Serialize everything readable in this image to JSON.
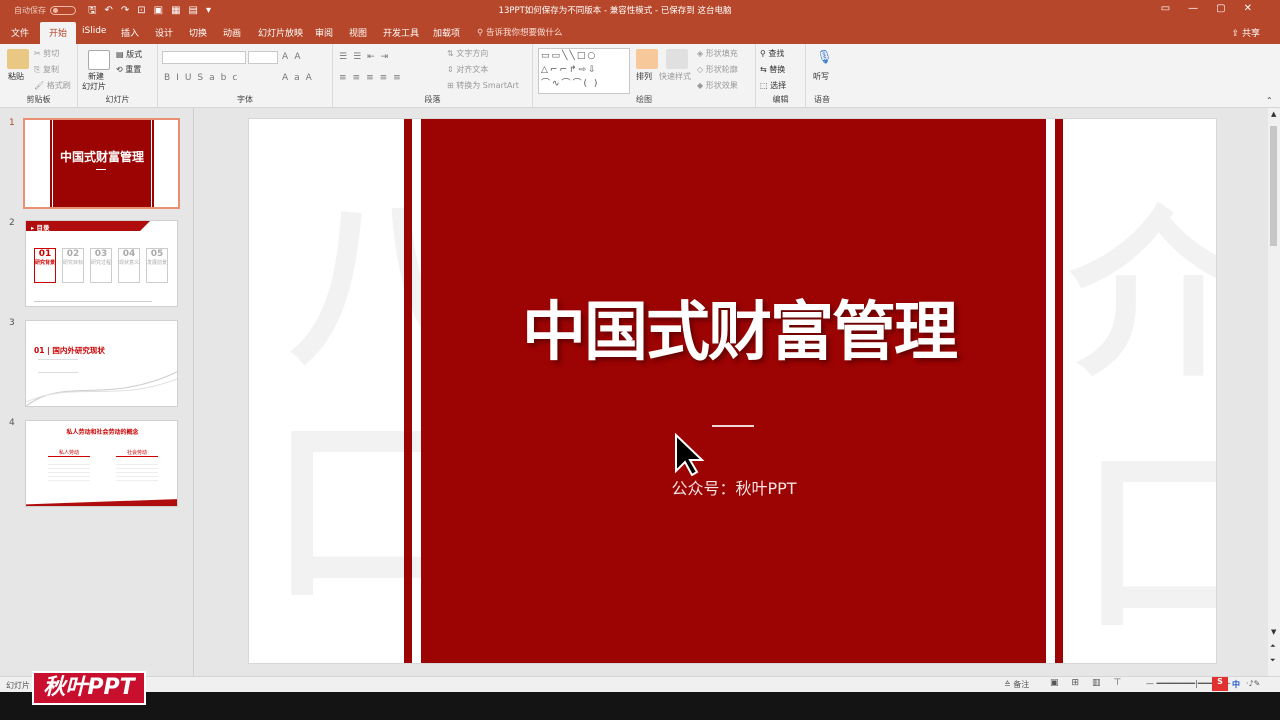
{
  "titlebar": {
    "autosave": "自动保存",
    "autosave_state": "关",
    "title": "13PPT如何保存为不同版本 - 兼容性模式 - 已保存到 这台电脑"
  },
  "tabs": [
    "文件",
    "开始",
    "iSlide",
    "插入",
    "设计",
    "切换",
    "动画",
    "幻灯片放映",
    "审阅",
    "视图",
    "开发工具",
    "加载项"
  ],
  "active_tab": "开始",
  "tellme": "告诉我你想要做什么",
  "share": "共享",
  "ribbon": {
    "clipboard": {
      "label": "剪贴板",
      "paste": "粘贴",
      "cut": "剪切",
      "copy": "复制",
      "painter": "格式刷"
    },
    "slides": {
      "label": "幻灯片",
      "new_slide_1": "新建",
      "new_slide_2": "幻灯片",
      "layout": "版式",
      "reset": "重置"
    },
    "font": {
      "label": "字体"
    },
    "paragraph": {
      "label": "段落",
      "text_dir": "文字方向",
      "align_text": "对齐文本",
      "smartart": "转换为 SmartArt"
    },
    "drawing": {
      "label": "绘图",
      "arrange": "排列",
      "quick_styles": "快速样式",
      "fill": "形状填充",
      "outline": "形状轮廓",
      "effects": "形状效果"
    },
    "editing": {
      "label": "编辑",
      "find": "查找",
      "replace": "替换",
      "select": "选择"
    },
    "voice": {
      "label": "语音",
      "dictate": "听写"
    }
  },
  "thumbnails": [
    {
      "num": "1",
      "title": "中国式财富管理"
    },
    {
      "num": "2",
      "header": "目录",
      "items": [
        {
          "n": "01",
          "t": "研究背景"
        },
        {
          "n": "02",
          "t": "研究目标"
        },
        {
          "n": "03",
          "t": "研究过程"
        },
        {
          "n": "04",
          "t": "现状意义"
        },
        {
          "n": "05",
          "t": "发展前景"
        }
      ]
    },
    {
      "num": "3",
      "title": "01 | 国内外研究现状"
    },
    {
      "num": "4",
      "title": "私人劳动和社会劳动的概念",
      "left": "私人劳动",
      "right": "社会劳动"
    }
  ],
  "slide": {
    "title": "中国式财富管理",
    "subtitle": "公众号：秋叶PPT"
  },
  "status": {
    "slide_label": "幻灯片",
    "notes": "备注",
    "lang": "中"
  },
  "watermark": "秋叶PPT",
  "colors": {
    "accent": "#b7472a",
    "slide_red": "#9c0303"
  }
}
